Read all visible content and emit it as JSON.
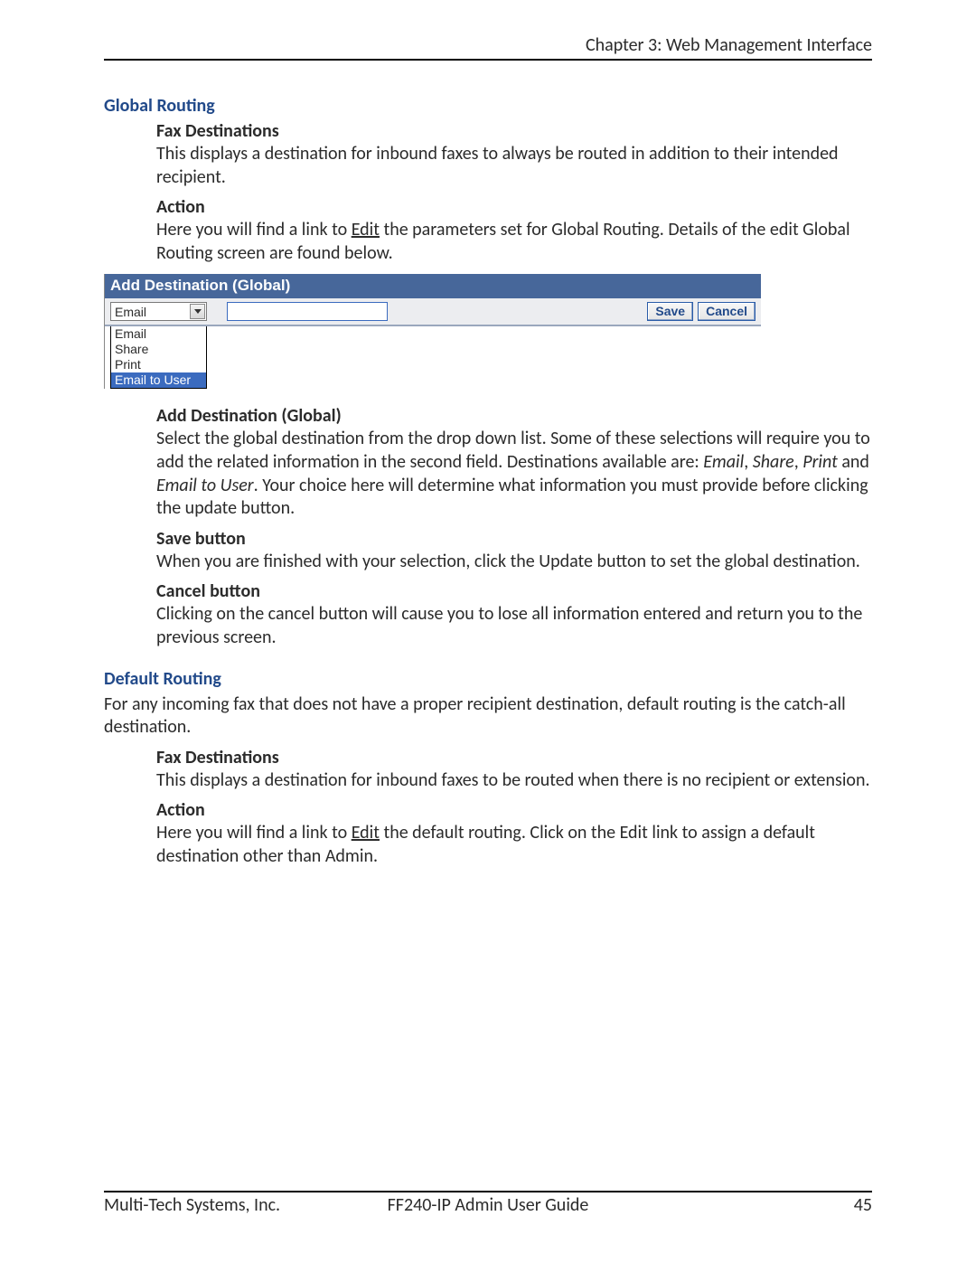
{
  "header": {
    "chapter": "Chapter 3: Web Management Interface"
  },
  "footer": {
    "left": "Multi-Tech Systems, Inc.",
    "center": "FF240-IP Admin User Guide",
    "right": "45"
  },
  "global_routing": {
    "title": "Global Routing",
    "fax_dest": {
      "h": "Fax Destinations",
      "p": "This displays a destination for inbound faxes to always be routed in addition to their intended recipient."
    },
    "action": {
      "h": "Action",
      "p1a": "Here you will find a link to ",
      "p1_link": "Edit",
      "p1b": " the parameters set for Global Routing. Details of the edit Global Routing screen are found below."
    }
  },
  "widget": {
    "title": "Add Destination (Global)",
    "select_value": "Email",
    "options": [
      "Email",
      "Share",
      "Print",
      "Email to User"
    ],
    "save": "Save",
    "cancel": "Cancel"
  },
  "add_dest": {
    "h": "Add Destination (Global)",
    "p1a": "Select the global destination from the drop down list. Some of these selections will require you to add the related information in the second field. Destinations available are: ",
    "em1": "Email",
    "sep1": ", ",
    "em2": "Share",
    "sep2": ", ",
    "em3": "Print",
    "p1b": " and ",
    "em4": "Email to User",
    "p1c": ". Your choice here will determine what information you must provide before clicking the update button."
  },
  "save_btn": {
    "h": "Save button",
    "p": "When you are finished with your selection, click the Update button to set the global destination."
  },
  "cancel_btn": {
    "h": "Cancel button",
    "p": "Clicking on the cancel button will cause you to lose all information entered and return you to the previous screen."
  },
  "default_routing": {
    "title": "Default Routing",
    "intro": "For any incoming fax that does not have a proper recipient destination, default routing is the catch-all destination.",
    "fax_dest": {
      "h": "Fax Destinations",
      "p": "This displays a destination for inbound faxes to be routed when there is no recipient or extension."
    },
    "action": {
      "h": "Action",
      "p1a": "Here you will find a link to ",
      "p1_link": "Edit",
      "p1b": " the default routing. Click on the Edit link to assign a default destination other than Admin."
    }
  }
}
